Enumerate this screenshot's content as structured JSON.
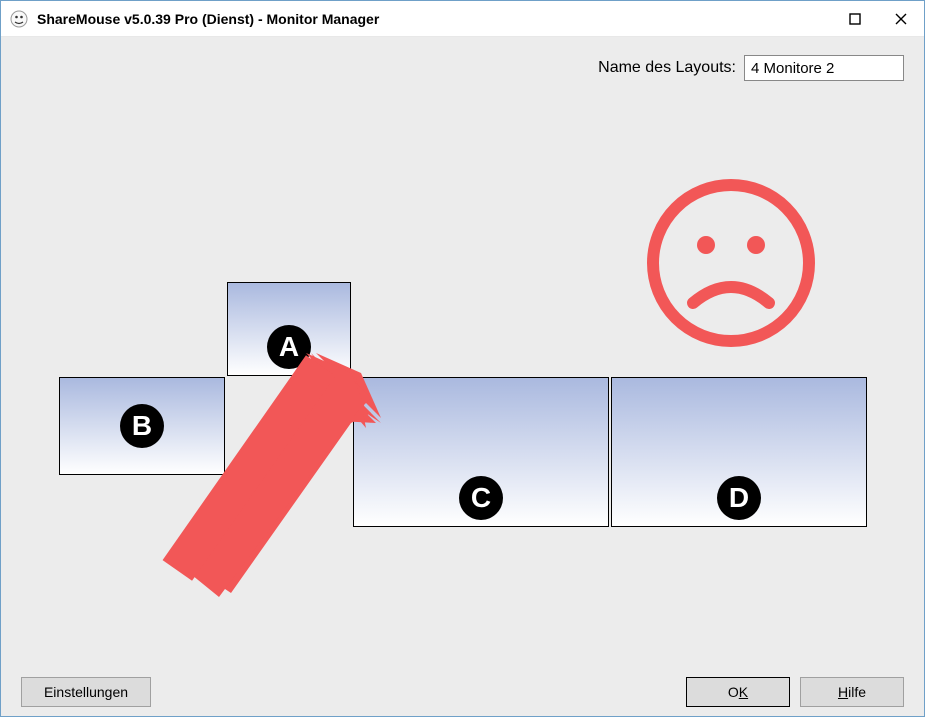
{
  "window": {
    "title": "ShareMouse v5.0.39 Pro (Dienst) - Monitor Manager"
  },
  "layout": {
    "label": "Name des Layouts:",
    "value": "4 Monitore 2"
  },
  "monitors": {
    "A": "A",
    "B": "B",
    "C": "C",
    "D": "D"
  },
  "footer": {
    "settings": "Einstellungen",
    "ok_prefix": "O",
    "ok_u": "K",
    "help_u": "H",
    "help_rest": "ilfe"
  },
  "annotation": {
    "sad_color": "#f25757",
    "arrow_color": "#f25757"
  }
}
